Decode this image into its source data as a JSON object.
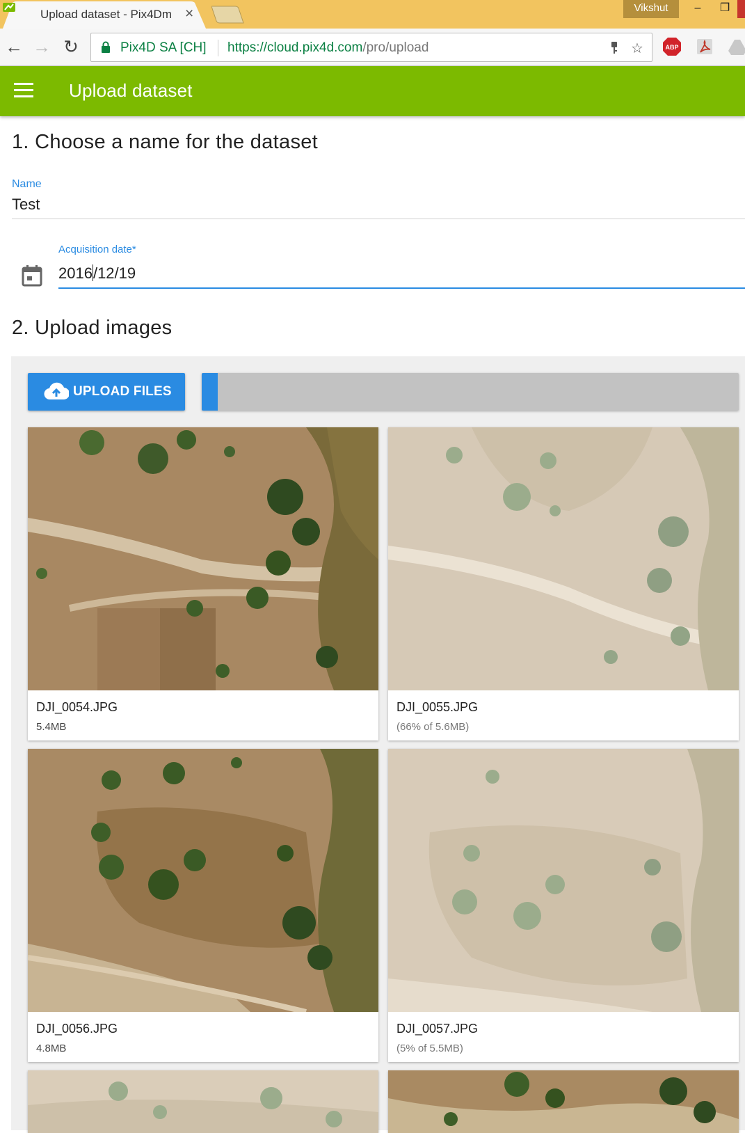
{
  "browser": {
    "tab_title": "Upload dataset - Pix4Dm",
    "tab_close": "×",
    "profile_name": "Vikshut",
    "back_glyph": "←",
    "forward_glyph": "→",
    "reload_glyph": "↻",
    "org_name": "Pix4D SA [CH]",
    "url_host": "https://cloud.pix4d.com",
    "url_path": "/pro/upload",
    "minimize_glyph": "–",
    "restore_glyph": "❐",
    "star_glyph": "☆",
    "extension_abp": "ABP"
  },
  "appbar": {
    "title": "Upload dataset"
  },
  "step1": {
    "title": "1. Choose a name for the dataset",
    "name_label": "Name",
    "name_value": "Test",
    "date_label": "Acquisition date*",
    "date_value_before_caret": "2016",
    "date_value_after_caret": "/12/19"
  },
  "step2": {
    "title": "2. Upload images",
    "upload_button": "UPLOAD FILES",
    "overall_progress": 0.03,
    "files": [
      {
        "name": "DJI_0054.JPG",
        "size": "5.4MB",
        "status": "done"
      },
      {
        "name": "DJI_0055.JPG",
        "size": "(66% of 5.6MB)",
        "status": "uploading"
      },
      {
        "name": "DJI_0056.JPG",
        "size": "4.8MB",
        "status": "done"
      },
      {
        "name": "DJI_0057.JPG",
        "size": "(5% of 5.5MB)",
        "status": "uploading"
      }
    ]
  },
  "colors": {
    "appbar": "#7cba00",
    "accent_blue": "#2a8be2",
    "titlebar": "#f2c45f"
  }
}
